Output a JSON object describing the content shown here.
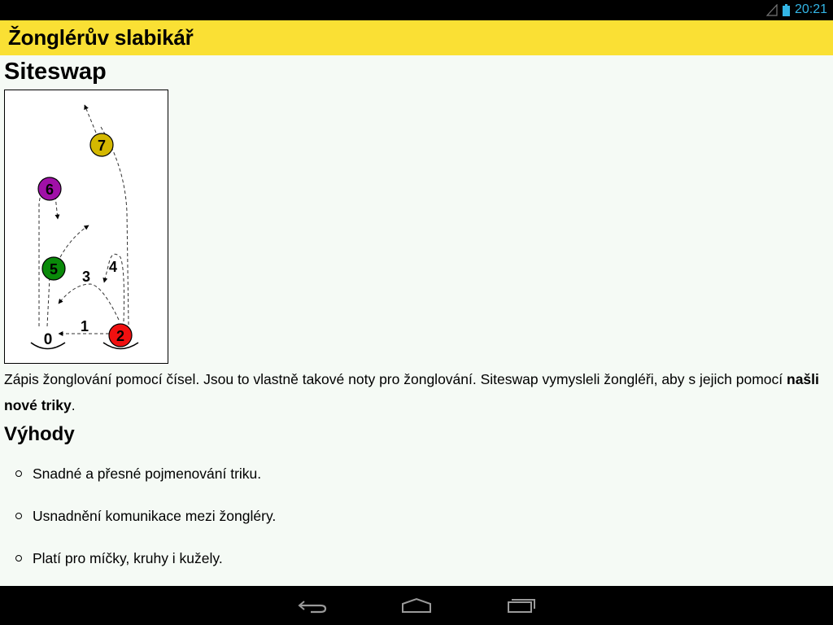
{
  "status_bar": {
    "time": "20:21",
    "icons": [
      "signal-icon",
      "battery-icon"
    ],
    "accent_color": "#33b5e5"
  },
  "header": {
    "title": "Žonglérův slabikář",
    "background": "#fae034"
  },
  "page": {
    "heading": "Siteswap",
    "intro": "Zápis žonglování pomocí čísel. Jsou to vlastně takové noty pro žonglování. Siteswap vymysleli žongléři, aby s jejich pomocí ",
    "intro_bold": "našli nové triky",
    "intro_end": ".",
    "advantages_heading": "Výhody",
    "advantages": [
      "Snadné a přesné pojmenování triku.",
      "Usnadnění komunikace mezi žongléry.",
      "Platí pro míčky, kruhy i kužely."
    ]
  },
  "diagram": {
    "balls": [
      {
        "label": "7",
        "color": "#d4b800"
      },
      {
        "label": "6",
        "color": "#a010a8"
      },
      {
        "label": "5",
        "color": "#0a8a0a"
      },
      {
        "label": "2",
        "color": "#f01010"
      }
    ],
    "labels": [
      "0",
      "1",
      "3",
      "4"
    ]
  },
  "nav_bar": {
    "buttons": [
      "back-icon",
      "home-icon",
      "recent-apps-icon"
    ]
  }
}
